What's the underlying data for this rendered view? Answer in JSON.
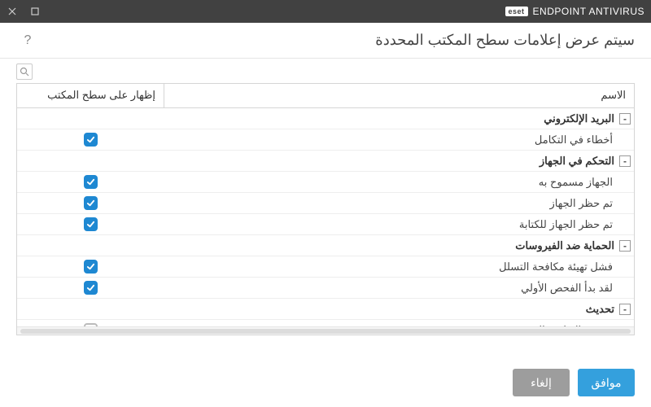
{
  "app": {
    "brand_badge": "eset",
    "brand_name": "ENDPOINT ANTIVIRUS"
  },
  "header": {
    "title": "سيتم عرض إعلامات سطح المكتب المحددة"
  },
  "columns": {
    "name": "الاسم",
    "show": "إظهار على سطح المكتب"
  },
  "groups": [
    {
      "label": "البريد الإلكتروني",
      "items": [
        {
          "name": "أخطاء في التكامل",
          "checked": true
        }
      ]
    },
    {
      "label": "التحكم في الجهاز",
      "items": [
        {
          "name": "الجهاز مسموح به",
          "checked": true
        },
        {
          "name": "تم حظر الجهاز",
          "checked": true
        },
        {
          "name": "تم حظر الجهاز للكتابة",
          "checked": true
        }
      ]
    },
    {
      "label": "الحماية ضد الفيروسات",
      "items": [
        {
          "name": "فشل تهيئة مكافحة التسلل",
          "checked": true
        },
        {
          "name": "لقد بدأ الفحص الأولي",
          "checked": true
        }
      ]
    },
    {
      "label": "تحديث",
      "items": [
        {
          "name": "تحديث التطبيق الجديد متوفر",
          "checked": false
        }
      ]
    }
  ],
  "footer": {
    "ok": "موافق",
    "cancel": "إلغاء"
  }
}
